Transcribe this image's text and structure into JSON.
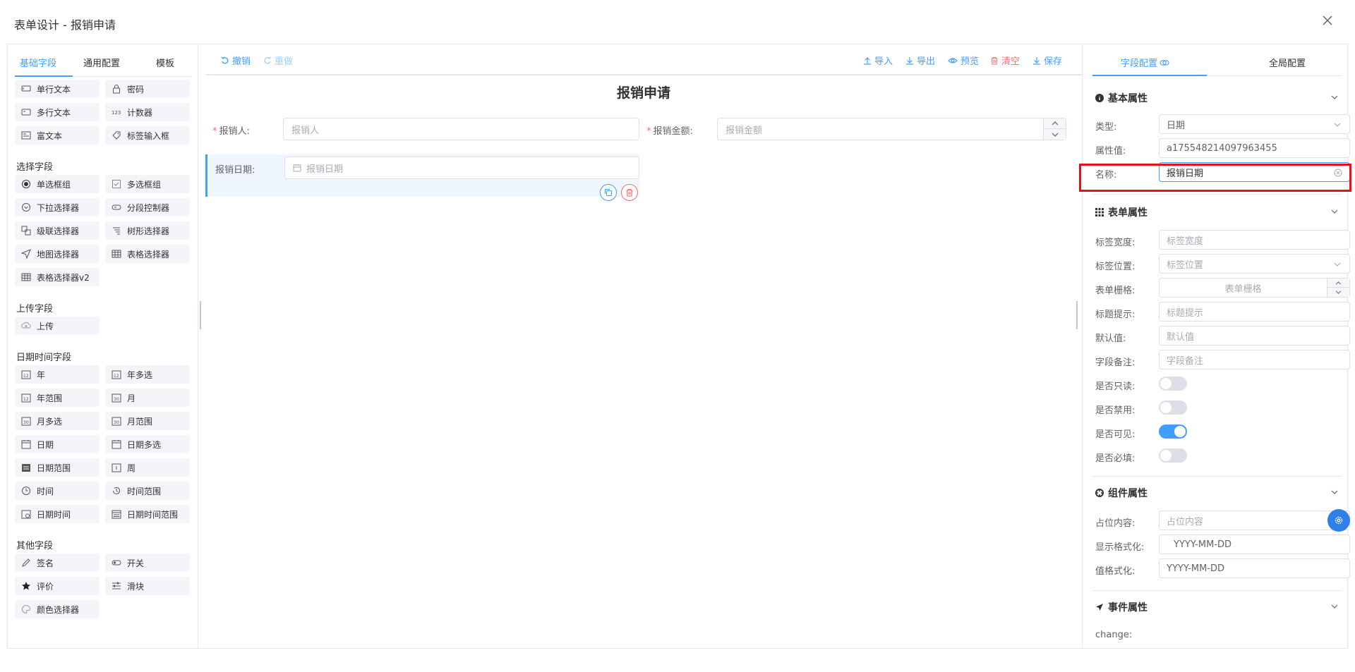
{
  "dialog": {
    "title": "表单设计 - 报销申请"
  },
  "left": {
    "tabs": [
      "基础字段",
      "通用配置",
      "模板"
    ],
    "groups": [
      {
        "title": "",
        "items": [
          {
            "label": "单行文本",
            "icon": "input-icon"
          },
          {
            "label": "密码",
            "icon": "lock-icon"
          },
          {
            "label": "多行文本",
            "icon": "textarea-icon"
          },
          {
            "label": "计数器",
            "icon": "counter-icon"
          },
          {
            "label": "富文本",
            "icon": "richtext-icon"
          },
          {
            "label": "标签输入框",
            "icon": "tag-icon"
          }
        ]
      },
      {
        "title": "选择字段",
        "items": [
          {
            "label": "单选框组",
            "icon": "radio-icon"
          },
          {
            "label": "多选框组",
            "icon": "checkbox-icon"
          },
          {
            "label": "下拉选择器",
            "icon": "select-icon"
          },
          {
            "label": "分段控制器",
            "icon": "segmented-icon"
          },
          {
            "label": "级联选择器",
            "icon": "cascader-icon"
          },
          {
            "label": "树形选择器",
            "icon": "tree-icon"
          },
          {
            "label": "地图选择器",
            "icon": "map-icon"
          },
          {
            "label": "表格选择器",
            "icon": "table-icon"
          },
          {
            "label": "表格选择器v2",
            "icon": "table-icon"
          }
        ]
      },
      {
        "title": "上传字段",
        "items": [
          {
            "label": "上传",
            "icon": "upload-icon"
          }
        ]
      },
      {
        "title": "日期时间字段",
        "items": [
          {
            "label": "年",
            "icon": "calendar-12-icon"
          },
          {
            "label": "年多选",
            "icon": "calendar-12-icon"
          },
          {
            "label": "年范围",
            "icon": "calendar-12-icon"
          },
          {
            "label": "月",
            "icon": "calendar-30-icon"
          },
          {
            "label": "月多选",
            "icon": "calendar-30-icon"
          },
          {
            "label": "月范围",
            "icon": "calendar-30-icon"
          },
          {
            "label": "日期",
            "icon": "calendar-icon"
          },
          {
            "label": "日期多选",
            "icon": "calendar-icon"
          },
          {
            "label": "日期范围",
            "icon": "calendar-range-icon"
          },
          {
            "label": "周",
            "icon": "week-icon"
          },
          {
            "label": "时间",
            "icon": "clock-icon"
          },
          {
            "label": "时间范围",
            "icon": "clock-range-icon"
          },
          {
            "label": "日期时间",
            "icon": "datetime-icon"
          },
          {
            "label": "日期时间范围",
            "icon": "datetime-range-icon"
          }
        ]
      },
      {
        "title": "其他字段",
        "items": [
          {
            "label": "签名",
            "icon": "pen-icon"
          },
          {
            "label": "开关",
            "icon": "switch-icon"
          },
          {
            "label": "评价",
            "icon": "star-icon"
          },
          {
            "label": "滑块",
            "icon": "slider-icon"
          },
          {
            "label": "颜色选择器",
            "icon": "palette-icon"
          }
        ]
      }
    ]
  },
  "toolbar": {
    "undo": "撤销",
    "redo": "重做",
    "import": "导入",
    "export": "导出",
    "preview": "预览",
    "clear": "清空",
    "save": "保存"
  },
  "form": {
    "title": "报销申请",
    "fields": [
      {
        "label": "报销人:",
        "required_mark": "*",
        "placeholder": "报销人"
      },
      {
        "label": "报销金额:",
        "required_mark": "*",
        "placeholder": "报销金额"
      },
      {
        "label": "报销日期:",
        "placeholder": "报销日期"
      }
    ]
  },
  "right": {
    "tabs": [
      "字段配置",
      "全局配置"
    ],
    "basic": {
      "title": "基本属性",
      "type_label": "类型:",
      "type_value": "日期",
      "prop_label": "属性值:",
      "prop_value": "a175548214097963455",
      "name_label": "名称:",
      "name_value": "报销日期"
    },
    "form_props": {
      "title": "表单属性",
      "rows": [
        {
          "label": "标签宽度:",
          "placeholder": "标签宽度"
        },
        {
          "label": "标签位置:",
          "placeholder": "标签位置"
        },
        {
          "label": "表单栅格:",
          "placeholder": "表单栅格"
        },
        {
          "label": "标题提示:",
          "placeholder": "标题提示"
        },
        {
          "label": "默认值:",
          "placeholder": "默认值"
        },
        {
          "label": "字段备注:",
          "placeholder": "字段备注"
        }
      ],
      "toggles": [
        {
          "label": "是否只读:",
          "on": false
        },
        {
          "label": "是否禁用:",
          "on": false
        },
        {
          "label": "是否可见:",
          "on": true
        },
        {
          "label": "是否必填:",
          "on": false
        }
      ]
    },
    "component": {
      "title": "组件属性",
      "placeholder_label": "占位内容:",
      "placeholder_hint": "占位内容",
      "display_label": "显示格式化:",
      "display_value": "YYYY-MM-DD",
      "value_label": "值格式化:",
      "value_value": "YYYY-MM-DD"
    },
    "events": {
      "title": "事件属性",
      "change_label": "change:"
    }
  },
  "colors": {
    "primary": "#409eff",
    "danger": "#f56c6c",
    "highlight": "#e8101c"
  }
}
